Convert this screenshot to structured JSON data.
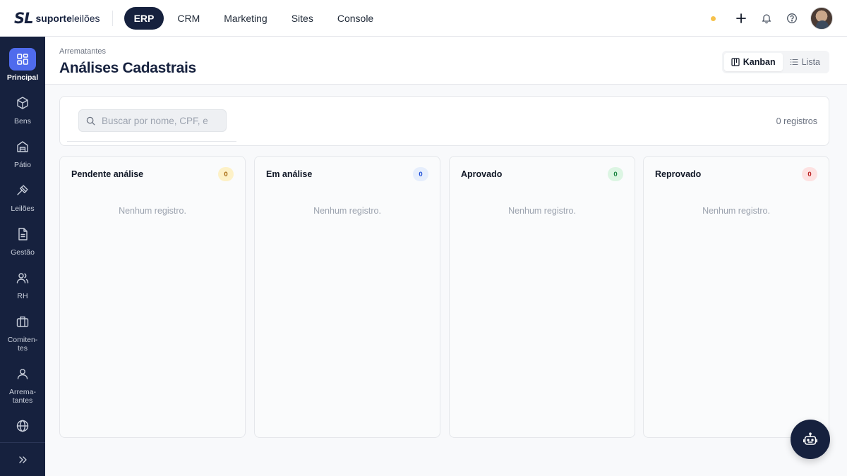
{
  "brand": {
    "mark": "SL",
    "name_bold": "suporte",
    "name_light": "leilões"
  },
  "nav": [
    {
      "label": "ERP",
      "active": true
    },
    {
      "label": "CRM"
    },
    {
      "label": "Marketing"
    },
    {
      "label": "Sites"
    },
    {
      "label": "Console"
    }
  ],
  "top_actions": {
    "status_dot_color": "#f6c14b",
    "icons": [
      "plus-icon",
      "bell-icon",
      "help-icon"
    ]
  },
  "sidebar": {
    "items": [
      {
        "label": "Principal",
        "icon": "grid-icon",
        "active": true
      },
      {
        "label": "Bens",
        "icon": "box-icon"
      },
      {
        "label": "Pátio",
        "icon": "warehouse-icon"
      },
      {
        "label": "Leilões",
        "icon": "gavel-icon"
      },
      {
        "label": "Gestão",
        "icon": "document-icon"
      },
      {
        "label": "RH",
        "icon": "users-icon"
      },
      {
        "label": "Comiten-tes",
        "icon": "briefcase-icon"
      },
      {
        "label": "Arrema-tantes",
        "icon": "user-icon"
      },
      {
        "label": "",
        "icon": "globe-icon"
      }
    ],
    "expand_icon": "chevrons-right-icon"
  },
  "header": {
    "breadcrumb": "Arrematantes",
    "title": "Análises Cadastrais",
    "views": [
      {
        "label": "Kanban",
        "active": true,
        "icon": "kanban-icon"
      },
      {
        "label": "Lista",
        "icon": "list-icon"
      }
    ]
  },
  "search": {
    "placeholder": "Buscar por nome, CPF, e",
    "value": "",
    "count_label": "0 registros"
  },
  "columns": [
    {
      "title": "Pendente análise",
      "count": "0",
      "badge_bg": "#fdf1c7",
      "badge_fg": "#a16207",
      "empty": "Nenhum registro."
    },
    {
      "title": "Em análise",
      "count": "0",
      "badge_bg": "#e6eefc",
      "badge_fg": "#1d4ed8",
      "empty": "Nenhum registro."
    },
    {
      "title": "Aprovado",
      "count": "0",
      "badge_bg": "#dcf5e3",
      "badge_fg": "#15803d",
      "empty": "Nenhum registro."
    },
    {
      "title": "Reprovado",
      "count": "0",
      "badge_bg": "#fde2e2",
      "badge_fg": "#b91c1c",
      "empty": "Nenhum registro."
    }
  ],
  "assistant": {
    "icon": "robot-icon"
  },
  "colors": {
    "navy": "#16213e",
    "accent": "#4f6bed"
  }
}
